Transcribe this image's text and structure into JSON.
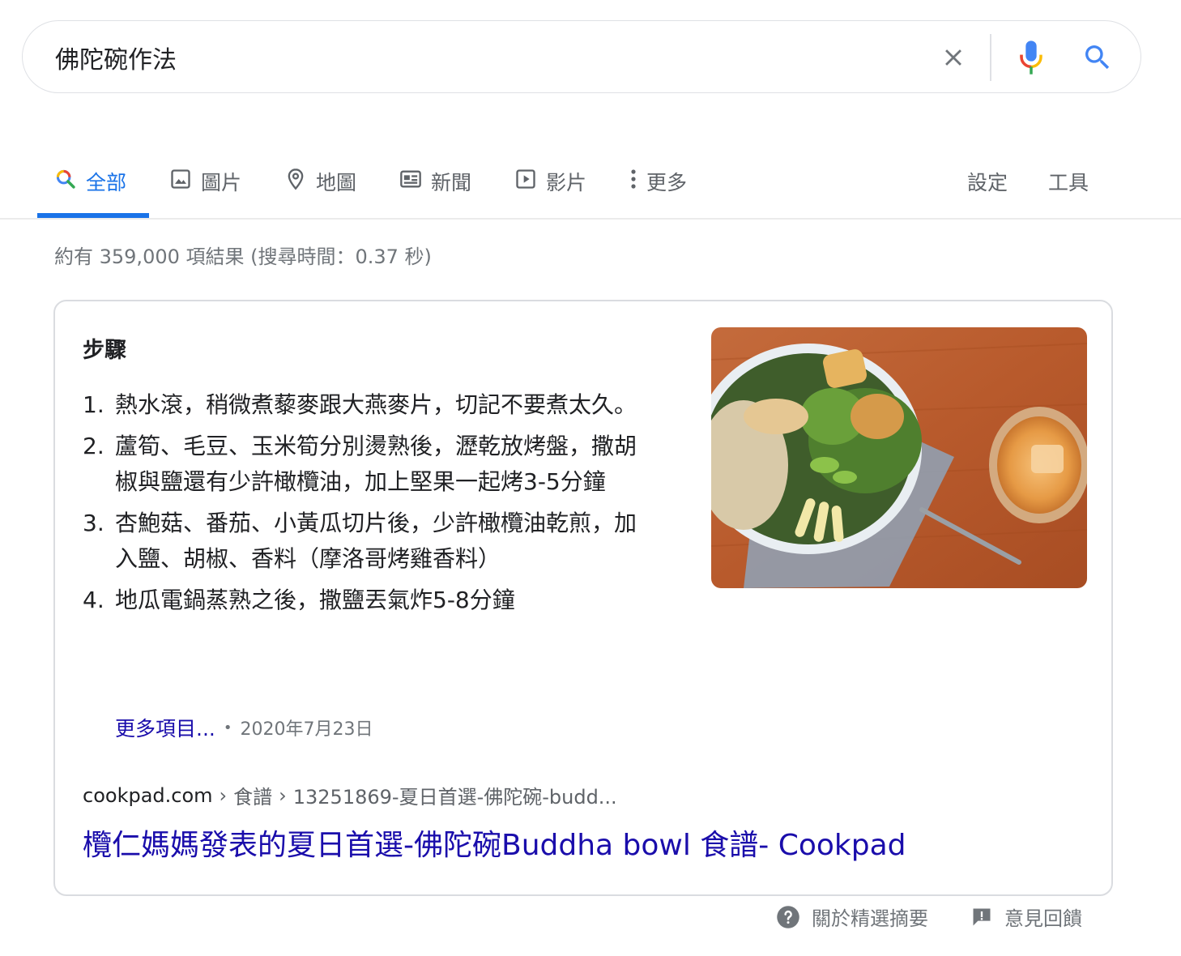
{
  "search": {
    "query": "佛陀碗作法"
  },
  "tabs": [
    {
      "label": "全部",
      "icon": "search-multicolor-icon",
      "active": true
    },
    {
      "label": "圖片",
      "icon": "image-icon"
    },
    {
      "label": "地圖",
      "icon": "map-pin-icon"
    },
    {
      "label": "新聞",
      "icon": "newspaper-icon"
    },
    {
      "label": "影片",
      "icon": "video-play-icon"
    },
    {
      "label": "更多",
      "icon": "more-vert-icon"
    }
  ],
  "settings_label": "設定",
  "tools_label": "工具",
  "result_stats": "約有 359,000 項結果 (搜尋時間：0.37 秒)",
  "snippet": {
    "heading": "步驟",
    "steps": [
      {
        "num": "1.",
        "text": "熱水滾，稍微煮藜麥跟大燕麥片，切記不要煮太久。"
      },
      {
        "num": "2.",
        "text": "蘆筍、毛豆、玉米筍分別燙熟後，瀝乾放烤盤，撒胡椒與鹽還有少許橄欖油，加上堅果一起烤3-5分鐘"
      },
      {
        "num": "3.",
        "text": "杏鮑菇、番茄、小黃瓜切片後，少許橄欖油乾煎，加入鹽、胡椒、香料（摩洛哥烤雞香料）"
      },
      {
        "num": "4.",
        "text": "地瓜電鍋蒸熟之後，撒鹽丟氣炸5-8分鐘"
      }
    ],
    "more_items": "更多項目...",
    "bullet": "•",
    "date": "2020年7月23日",
    "breadcrumb": {
      "domain": "cookpad.com",
      "sep": "›",
      "crumb1": "食譜",
      "crumb2": "13251869-夏日首選-佛陀碗-budd..."
    },
    "title": "欖仁媽媽發表的夏日首選-佛陀碗Buddha bowl 食譜- Cookpad"
  },
  "footer": {
    "about": "關於精選摘要",
    "feedback": "意見回饋"
  },
  "colors": {
    "accent": "#1a73e8",
    "link": "#1a0dab",
    "muted": "#70757a"
  }
}
